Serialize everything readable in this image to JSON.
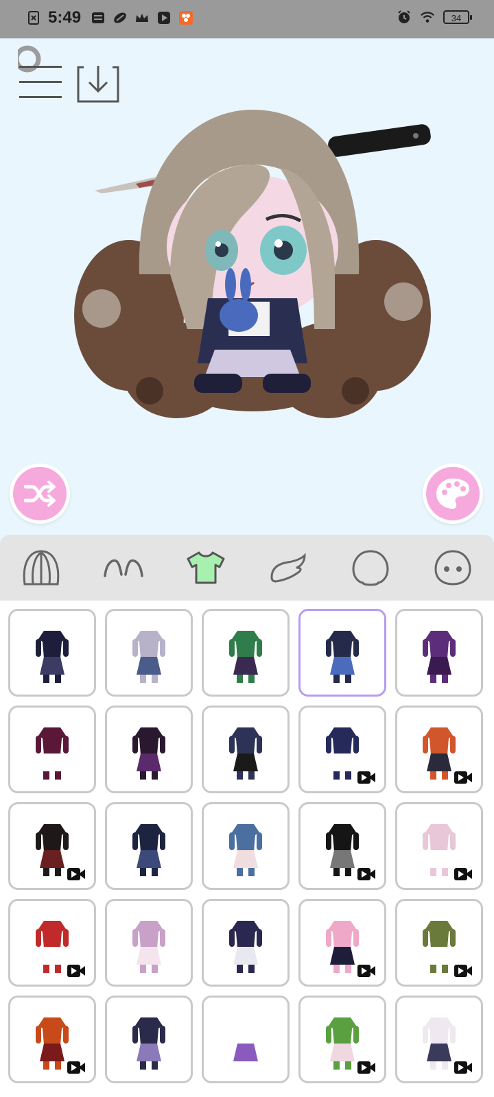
{
  "status_bar": {
    "time": "5:49",
    "battery": "34",
    "left_icons": [
      "sim-off-icon",
      "news-icon",
      "rugby-icon",
      "crown-icon",
      "play-store-icon",
      "app-icon"
    ],
    "right_icons": [
      "alarm-icon",
      "wifi-icon",
      "battery-icon"
    ]
  },
  "toolbar": {
    "menu_icon": "menu-icon",
    "save_icon": "download-icon"
  },
  "actions": {
    "shuffle_icon": "shuffle-icon",
    "palette_icon": "palette-icon",
    "accent": "#f6a9dd"
  },
  "tabs": [
    {
      "id": "hair-back",
      "icon": "hair-back-icon",
      "active": false
    },
    {
      "id": "eyebrows",
      "icon": "eyebrows-icon",
      "active": false
    },
    {
      "id": "clothes",
      "icon": "shirt-icon",
      "active": true,
      "color": "#a8f0b0"
    },
    {
      "id": "wings",
      "icon": "wing-icon",
      "active": false
    },
    {
      "id": "head",
      "icon": "head-outline-icon",
      "active": false
    },
    {
      "id": "face",
      "icon": "face-icon",
      "active": false
    }
  ],
  "outfits": [
    {
      "colors": [
        "#1e1e3c",
        "#3b3b63"
      ],
      "video": false,
      "selected": false
    },
    {
      "colors": [
        "#b7b2c9",
        "#4a5c8a"
      ],
      "video": false,
      "selected": false
    },
    {
      "colors": [
        "#2e7d4a",
        "#3a2950"
      ],
      "video": false,
      "selected": false
    },
    {
      "colors": [
        "#262a4a",
        "#4b6bbd"
      ],
      "video": false,
      "selected": true
    },
    {
      "colors": [
        "#5b2d7a",
        "#3a1a50"
      ],
      "video": false,
      "selected": false
    },
    {
      "colors": [
        "#5a1738",
        "#ffffff"
      ],
      "video": false,
      "selected": false
    },
    {
      "colors": [
        "#2a1830",
        "#5a2a6a"
      ],
      "video": false,
      "selected": false
    },
    {
      "colors": [
        "#2c3356",
        "#1a1a1a"
      ],
      "video": false,
      "selected": false
    },
    {
      "colors": [
        "#262a5a",
        "#ffffff"
      ],
      "video": true,
      "selected": false
    },
    {
      "colors": [
        "#d2562c",
        "#2a2a3a"
      ],
      "video": true,
      "selected": false
    },
    {
      "colors": [
        "#1e1818",
        "#6a2020"
      ],
      "video": true,
      "selected": false
    },
    {
      "colors": [
        "#1c2440",
        "#3b4a7a"
      ],
      "video": false,
      "selected": false
    },
    {
      "colors": [
        "#4a6fa0",
        "#f0dde0"
      ],
      "video": false,
      "selected": false
    },
    {
      "colors": [
        "#151515",
        "#777777"
      ],
      "video": true,
      "selected": false
    },
    {
      "colors": [
        "#e8c8d8",
        "#ffffff"
      ],
      "video": true,
      "selected": false
    },
    {
      "colors": [
        "#c02a2a",
        "#ffffff"
      ],
      "video": true,
      "selected": false
    },
    {
      "colors": [
        "#c8a0c8",
        "#f4e4ee"
      ],
      "video": false,
      "selected": false
    },
    {
      "colors": [
        "#2a2850",
        "#e8e8f0"
      ],
      "video": false,
      "selected": false
    },
    {
      "colors": [
        "#f0a8c8",
        "#1e1e3a"
      ],
      "video": true,
      "selected": false
    },
    {
      "colors": [
        "#6a7a3a",
        "#ffffff"
      ],
      "video": true,
      "selected": false
    },
    {
      "colors": [
        "#c84a1a",
        "#7a1a1a"
      ],
      "video": true,
      "selected": false
    },
    {
      "colors": [
        "#2a2a4a",
        "#8a7ab8"
      ],
      "video": false,
      "selected": false
    },
    {
      "colors": [
        "#ffffff",
        "#8a5abf"
      ],
      "video": false,
      "selected": false
    },
    {
      "colors": [
        "#5aa040",
        "#f0d8e0"
      ],
      "video": true,
      "selected": false
    },
    {
      "colors": [
        "#f0e8f0",
        "#3a3a5a"
      ],
      "video": true,
      "selected": false
    }
  ]
}
